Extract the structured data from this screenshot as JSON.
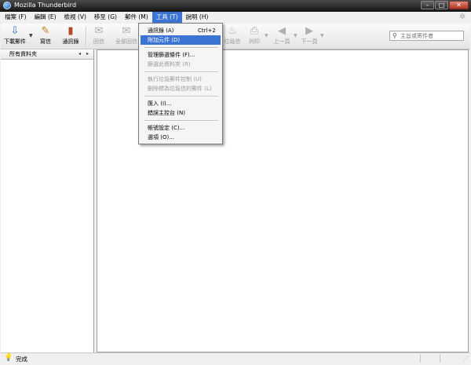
{
  "window": {
    "title": "Mozilla Thunderbird",
    "controls": {
      "minimize": "–",
      "maximize": "□",
      "close": "✕"
    }
  },
  "menubar": {
    "items": [
      "檔案 (F)",
      "編輯 (E)",
      "檢視 (V)",
      "移至 (G)",
      "郵件 (M)",
      "工具 (T)",
      "說明 (H)"
    ],
    "active_index": 5
  },
  "toolbar": {
    "get_mail": "下載郵件",
    "write": "寫信",
    "address_book": "通訊錄",
    "reply": "回信",
    "reply_all": "全部回信",
    "junk": "垃圾信",
    "print": "列印",
    "back": "上一頁",
    "forward": "下一頁"
  },
  "search": {
    "placeholder": "主旨或寄件者"
  },
  "folder_pane": {
    "header": "所有資料夾",
    "prev": "◂",
    "next": "▸"
  },
  "tools_menu": {
    "items": [
      {
        "label": "通訊錄 (A)",
        "shortcut": "Ctrl+2",
        "enabled": true
      },
      {
        "label": "附加元件 (D)",
        "shortcut": "",
        "enabled": true,
        "highlighted": true
      },
      {
        "label": "管理篩選條件 (F)...",
        "shortcut": "",
        "enabled": true
      },
      {
        "label": "篩選此資料夾 (R)",
        "shortcut": "",
        "enabled": false
      },
      {
        "label": "執行垃圾郵件控制 (U)",
        "shortcut": "",
        "enabled": false
      },
      {
        "label": "刪除標為垃圾信的郵件 (L)",
        "shortcut": "",
        "enabled": false
      },
      {
        "label": "匯入 (I)...",
        "shortcut": "",
        "enabled": true
      },
      {
        "label": "錯誤主控台 (N)",
        "shortcut": "",
        "enabled": true
      },
      {
        "label": "帳號設定 (C)...",
        "shortcut": "",
        "enabled": true
      },
      {
        "label": "選項 (O)...",
        "shortcut": "",
        "enabled": true
      }
    ]
  },
  "statusbar": {
    "text": "完成"
  },
  "colors": {
    "menu_highlight": "#3b74d4",
    "titlebar": "#141414",
    "disabled_text": "#9a9a9a"
  },
  "icons": [
    "thunderbird-app-icon",
    "get-mail-icon",
    "write-icon",
    "address-book-icon",
    "reply-icon",
    "reply-all-icon",
    "junk-icon",
    "print-icon",
    "back-arrow-icon",
    "forward-arrow-icon",
    "search-icon",
    "lightbulb-icon",
    "activity-throbber-icon"
  ]
}
